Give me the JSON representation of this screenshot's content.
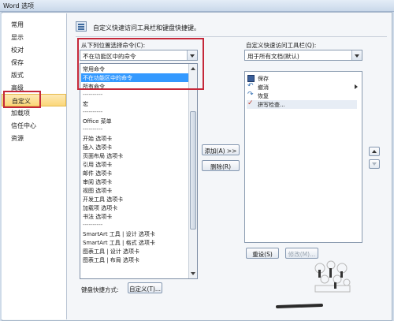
{
  "window": {
    "title": "Word 选项"
  },
  "sidebar": {
    "items": [
      {
        "label": "常用"
      },
      {
        "label": "显示"
      },
      {
        "label": "校对"
      },
      {
        "label": "保存"
      },
      {
        "label": "版式"
      },
      {
        "label": "高级"
      },
      {
        "label": "自定义",
        "selected": true
      },
      {
        "label": "加载项"
      },
      {
        "label": "信任中心"
      },
      {
        "label": "资源"
      }
    ]
  },
  "header": {
    "text": "自定义快速访问工具栏和键盘快捷键。"
  },
  "choose_from": {
    "label": "从下列位置选择命令(C):",
    "value": "不在功能区中的命令",
    "options": [
      "常用命令",
      "不在功能区中的命令",
      "所有命令",
      "----------",
      "宏",
      "----------",
      "Office 菜单",
      "----------",
      "开始 选项卡",
      "插入 选项卡",
      "页面布局 选项卡",
      "引用 选项卡",
      "邮件 选项卡",
      "审阅 选项卡",
      "视图 选项卡",
      "开发工具 选项卡",
      "加载项 选项卡",
      "书法 选项卡",
      "----------",
      "SmartArt 工具 | 设计 选项卡",
      "SmartArt 工具 | 格式 选项卡",
      "图表工具 | 设计 选项卡",
      "图表工具 | 布局 选项卡"
    ],
    "highlighted_option": "不在功能区中的命令"
  },
  "customize_qat": {
    "label": "自定义快速访问工具栏(Q):",
    "value": "用于所有文档(默认)",
    "items": [
      {
        "label": "保存",
        "icon": "save-icon"
      },
      {
        "label": "撤消",
        "icon": "undo-icon"
      },
      {
        "label": "恢复",
        "icon": "redo-icon"
      },
      {
        "label": "拼写检查...",
        "icon": "spelling-icon"
      }
    ]
  },
  "buttons": {
    "add": "添加(A) >>",
    "remove": "删除(R)",
    "reset": "重设(S)",
    "modify": "修改(M)..."
  },
  "keyboard": {
    "label": "键盘快捷方式:",
    "button": "自定义(T)..."
  },
  "colors": {
    "highlight_box": "#c5283a",
    "selection_blue": "#3399ff",
    "selected_nav": "#fbd77a"
  }
}
